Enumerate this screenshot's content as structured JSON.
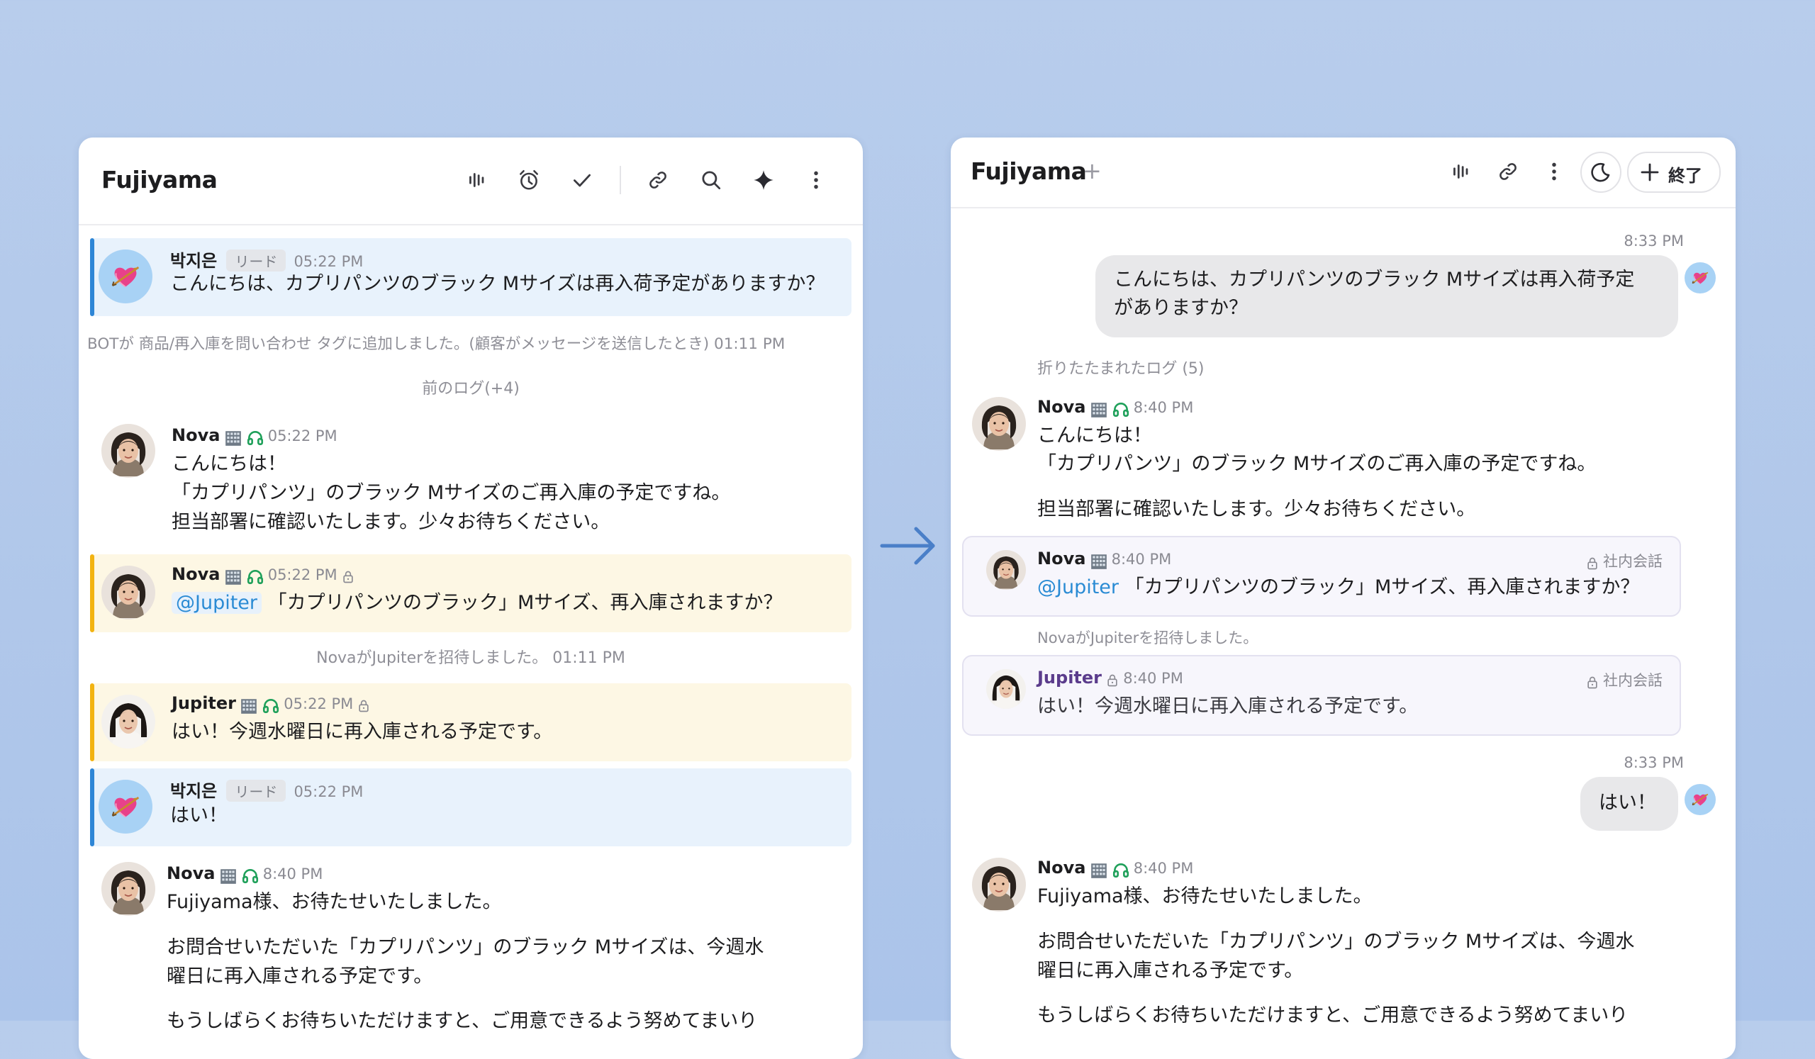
{
  "left": {
    "title": "Fujiyama",
    "messages": {
      "m1": {
        "name": "박지은",
        "tag": "リード",
        "time": "05:22 PM",
        "text": "こんにちは、カプリパンツのブラック Mサイズは再入荷予定がありますか？"
      },
      "sys1": "BOTが 商品/再入庫を問い合わせ タグに追加しました。(顧客がメッセージを送信したとき) 01:11 PM",
      "prev_log": "前のログ(+4)",
      "m2": {
        "name": "Nova",
        "time": "05:22 PM",
        "lines": [
          "こんにちは！",
          "「カプリパンツ」のブラック Mサイズのご再入庫の予定ですね。",
          "担当部署に確認いたします。少々お待ちください。"
        ]
      },
      "m3": {
        "name": "Nova",
        "time": "05:22 PM",
        "mention": "@Jupiter",
        "text": "「カプリパンツのブラック」Mサイズ、再入庫されますか？"
      },
      "sys2": "NovaがJupiterを招待しました。  01:11 PM",
      "m4": {
        "name": "Jupiter",
        "time": "05:22 PM",
        "text": "はい！今週水曜日に再入庫される予定です。"
      },
      "m5": {
        "name": "박지은",
        "tag": "リード",
        "time": "05:22 PM",
        "text": "はい！"
      },
      "m6": {
        "name": "Nova",
        "time": "8:40 PM",
        "lines": [
          "Fujiyama様、お待たせいたしました。",
          "お問合せいただいた「カプリパンツ」のブラック Mサイズは、今週水",
          "曜日に再入庫される予定です。",
          "もうしばらくお待ちいただけますと、ご用意できるよう努めてまいり"
        ]
      }
    }
  },
  "right": {
    "title": "Fujiyama",
    "plus": "+",
    "end_label": "終了",
    "messages": {
      "t1": "8:33 PM",
      "b1": [
        "こんにちは、カプリパンツのブラック Mサイズは再入荷予定",
        "がありますか？"
      ],
      "folded": "折りたたまれたログ (5)",
      "m2": {
        "name": "Nova",
        "time": "8:40 PM",
        "lines": [
          "こんにちは！",
          "「カプリパンツ」のブラック Mサイズのご再入庫の予定ですね。",
          "担当部署に確認いたします。少々お待ちください。"
        ]
      },
      "m3": {
        "name": "Nova",
        "time": "8:40 PM",
        "internal": "社内会話",
        "mention": "@Jupiter",
        "text": " 「カプリパンツのブラック」Mサイズ、再入庫されますか？"
      },
      "sys2": "NovaがJupiterを招待しました。",
      "m4": {
        "name": "Jupiter",
        "time": "8:40 PM",
        "internal": "社内会話",
        "text": "はい！今週水曜日に再入庫される予定です。"
      },
      "t2": "8:33 PM",
      "b2": "はい！",
      "m6": {
        "name": "Nova",
        "time": "8:40 PM",
        "lines": [
          "Fujiyama様、お待たせいたしました。",
          "お問合せいただいた「カプリパンツ」のブラック Mサイズは、今週水",
          "曜日に再入庫される予定です。",
          "もうしばらくお待ちいただけますと、ご用意できるよう努めてまいり"
        ]
      }
    }
  },
  "colors": {
    "blue_highlight": "#e8f2fc",
    "blue_bar": "#2e86d6",
    "yellow_highlight": "#fdf7e4",
    "yellow_bar": "#f2b311",
    "internal_bg": "#f7f6fc",
    "arrow": "#4a7fc8",
    "headset_green": "#1fa05a",
    "jupiter_name": "#5b3c8c"
  },
  "icons": [
    "audio-wave-icon",
    "alarm-clock-icon",
    "check-icon",
    "link-icon",
    "search-icon",
    "sparkle-icon",
    "more-vertical-icon",
    "moon-icon",
    "plus-icon",
    "lock-icon",
    "headset-icon",
    "building-icon",
    "heart-arrow-icon",
    "arrow-right-icon"
  ]
}
